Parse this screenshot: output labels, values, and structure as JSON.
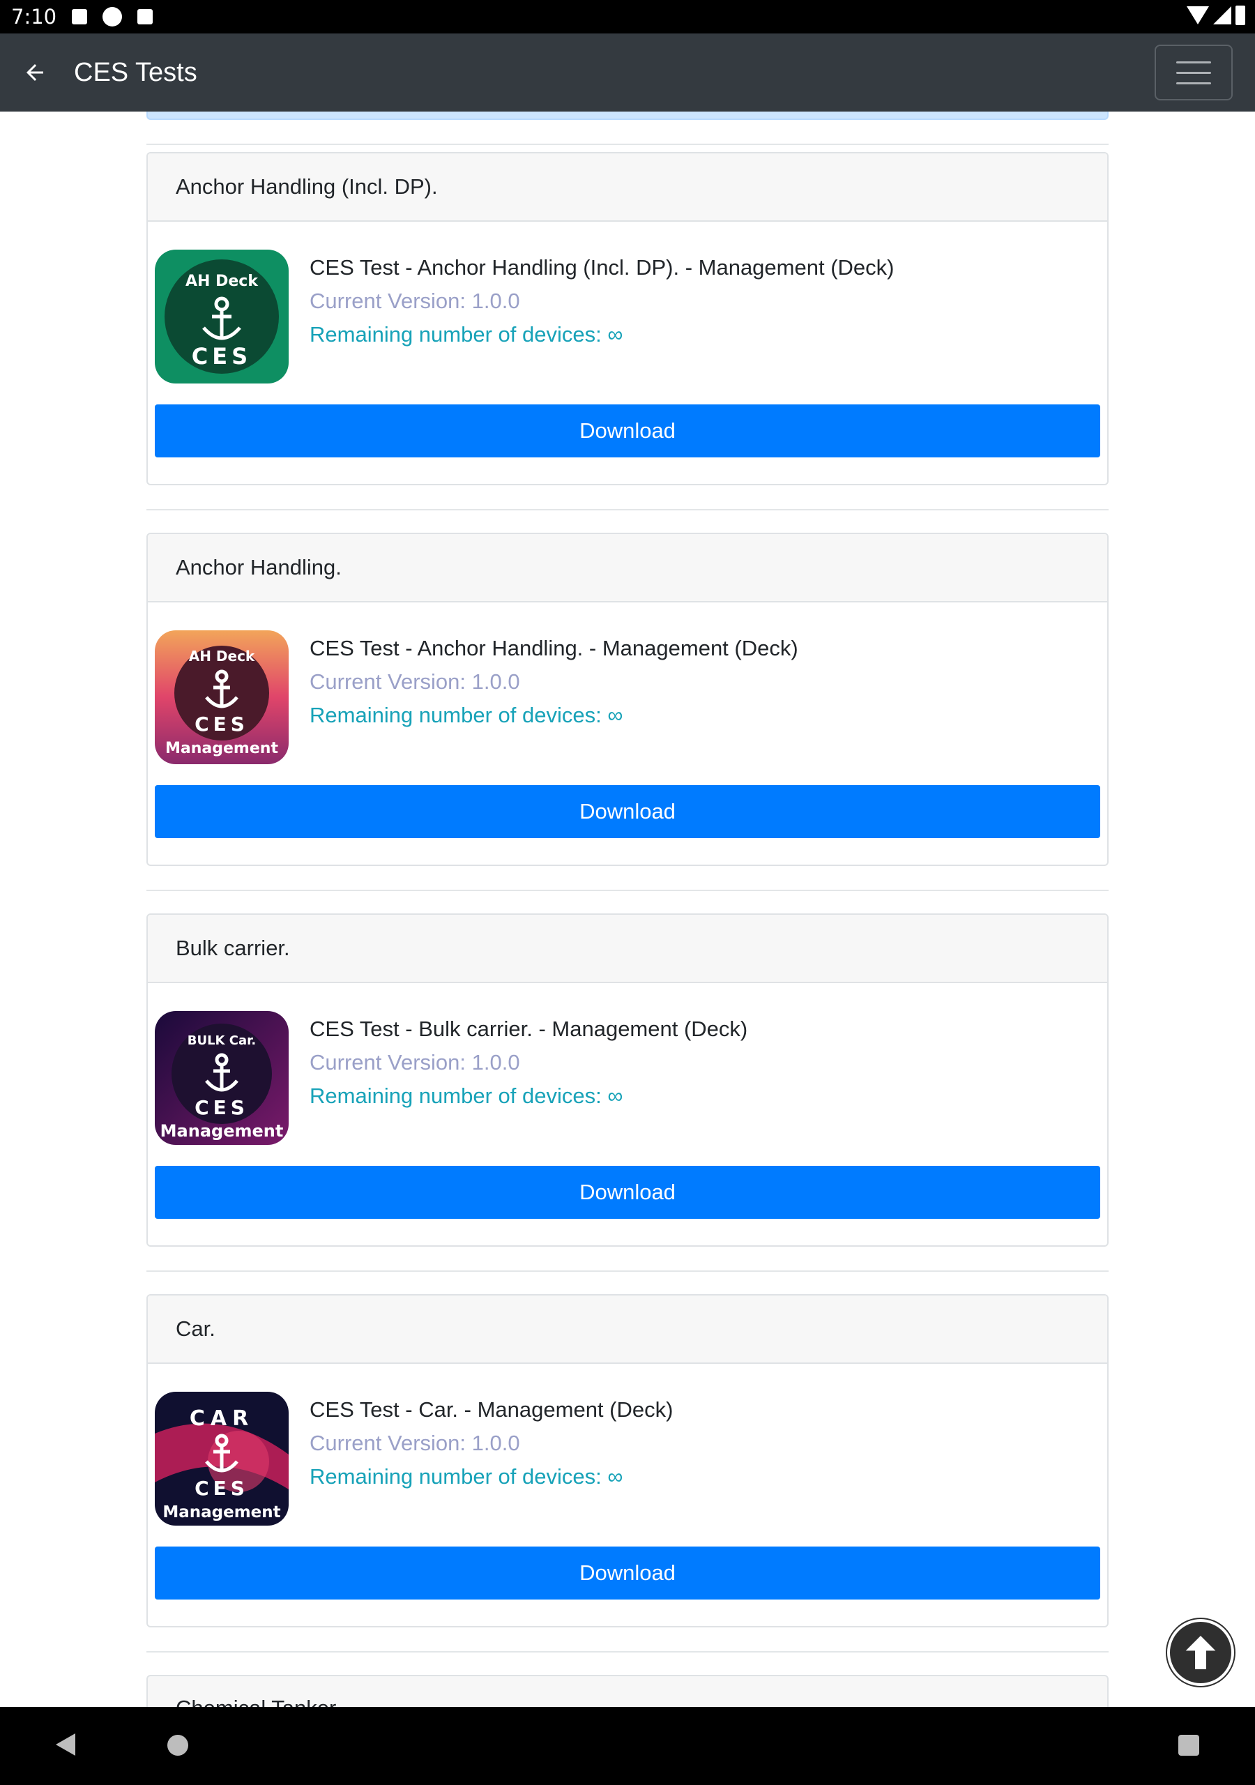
{
  "status_bar": {
    "time": "7:10"
  },
  "app_bar": {
    "title": "CES Tests"
  },
  "cards": [
    {
      "header": "Anchor Handling (Incl. DP).",
      "name": "CES Test - Anchor Handling (Incl. DP). - Management (Deck)",
      "version": "Current Version: 1.0.0",
      "remaining": "Remaining number of devices: ∞",
      "button": "Download",
      "icon": {
        "line1": "AH Deck",
        "line2": "CES",
        "line3": ""
      }
    },
    {
      "header": "Anchor Handling.",
      "name": "CES Test - Anchor Handling. - Management (Deck)",
      "version": "Current Version: 1.0.0",
      "remaining": "Remaining number of devices: ∞",
      "button": "Download",
      "icon": {
        "line1": "AH Deck",
        "line2": "CES",
        "line3": "Management"
      }
    },
    {
      "header": "Bulk carrier.",
      "name": "CES Test - Bulk carrier. - Management (Deck)",
      "version": "Current Version: 1.0.0",
      "remaining": "Remaining number of devices: ∞",
      "button": "Download",
      "icon": {
        "line1": "BULK Car.",
        "line2": "CES",
        "line3": "Management"
      }
    },
    {
      "header": "Car.",
      "name": "CES Test - Car. - Management (Deck)",
      "version": "Current Version: 1.0.0",
      "remaining": "Remaining number of devices: ∞",
      "button": "Download",
      "icon": {
        "line1": "CAR",
        "line2": "CES",
        "line3": "Management"
      }
    }
  ],
  "partial_card": {
    "header": "Chemical Tanker."
  },
  "colors": {
    "appbar": "#343a40",
    "button": "#007bff",
    "version": "#9aa0c8",
    "remaining": "#17a2b8"
  }
}
